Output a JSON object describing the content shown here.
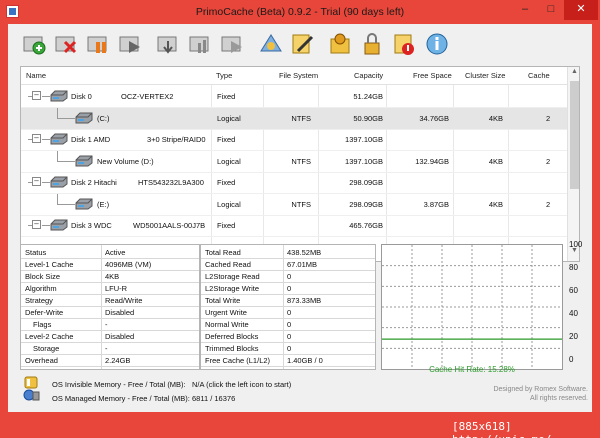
{
  "window": {
    "title": "PrimoCache (Beta) 0.9.2 - Trial (90 days left)",
    "accent": "#e8463a",
    "buttons": {
      "minimize": "–",
      "maximize": "□",
      "close": "✕"
    }
  },
  "toolbar": {
    "icons": [
      "add-cache-icon",
      "delete-cache-icon",
      "pause-cache-icon",
      "resume-cache-icon",
      "flush-cache-icon",
      "stats-icon",
      "play-icon",
      "settings-icon",
      "edit-icon",
      "options-icon",
      "lock-icon",
      "help-icon",
      "about-icon"
    ]
  },
  "tree": {
    "columns": [
      "Name",
      "Type",
      "File System",
      "Capacity",
      "Free Space",
      "Cluster Size",
      "Cache"
    ],
    "rows": [
      {
        "name": "Disk 0",
        "model": "OCZ-VERTEX2",
        "type": "Fixed",
        "fs": "",
        "capacity": "51.24GB",
        "free": "",
        "cluster": "",
        "cache": "",
        "level": 0
      },
      {
        "name": "(C:)",
        "model": "",
        "type": "Logical",
        "fs": "NTFS",
        "capacity": "50.90GB",
        "free": "34.76GB",
        "cluster": "4KB",
        "cache": "2",
        "level": 1,
        "selected": true
      },
      {
        "name": "Disk 1 AMD",
        "model": "3+0 Stripe/RAID0",
        "type": "Fixed",
        "fs": "",
        "capacity": "1397.10GB",
        "free": "",
        "cluster": "",
        "cache": "",
        "level": 0
      },
      {
        "name": "New Volume (D:)",
        "model": "",
        "type": "Logical",
        "fs": "NTFS",
        "capacity": "1397.10GB",
        "free": "132.94GB",
        "cluster": "4KB",
        "cache": "2",
        "level": 1
      },
      {
        "name": "Disk 2 Hitachi",
        "model": "HTS543232L9A300",
        "type": "Fixed",
        "fs": "",
        "capacity": "298.09GB",
        "free": "",
        "cluster": "",
        "cache": "",
        "level": 0
      },
      {
        "name": "(E:)",
        "model": "",
        "type": "Logical",
        "fs": "NTFS",
        "capacity": "298.09GB",
        "free": "3.87GB",
        "cluster": "4KB",
        "cache": "2",
        "level": 1
      },
      {
        "name": "Disk 3 WDC",
        "model": "WD5001AALS-00J7B",
        "type": "Fixed",
        "fs": "",
        "capacity": "465.76GB",
        "free": "",
        "cluster": "",
        "cache": "",
        "level": 0
      }
    ]
  },
  "status": [
    {
      "k": "Status",
      "v": "Active"
    },
    {
      "k": "Level-1 Cache",
      "v": "4096MB (VM)"
    },
    {
      "k": "Block Size",
      "v": "4KB"
    },
    {
      "k": "Algorithm",
      "v": "LFU-R"
    },
    {
      "k": "Strategy",
      "v": "Read/Write"
    },
    {
      "k": "Defer-Write",
      "v": "Disabled"
    },
    {
      "k": "Flags",
      "v": "-",
      "indent": true
    },
    {
      "k": "Level-2 Cache",
      "v": "Disabled"
    },
    {
      "k": "Storage",
      "v": "-",
      "indent": true
    },
    {
      "k": "Overhead",
      "v": "2.24GB"
    }
  ],
  "stats": [
    {
      "k": "Total Read",
      "v": "438.52MB"
    },
    {
      "k": "Cached Read",
      "v": "67.01MB"
    },
    {
      "k": "L2Storage Read",
      "v": "0"
    },
    {
      "k": "L2Storage Write",
      "v": "0"
    },
    {
      "k": "Total Write",
      "v": "873.33MB"
    },
    {
      "k": "Urgent Write",
      "v": "0"
    },
    {
      "k": "Normal Write",
      "v": "0"
    },
    {
      "k": "Deferred Blocks",
      "v": "0"
    },
    {
      "k": "Trimmed Blocks",
      "v": "0"
    },
    {
      "k": "Free Cache (L1/L2)",
      "v": "1.40GB / 0"
    }
  ],
  "graph": {
    "y_ticks": [
      "100",
      "80",
      "60",
      "40",
      "20",
      "0"
    ],
    "hit_rate_label": "Cache Hit Rate: 15.28%",
    "hit_rate": 15.28,
    "line_color": "#2a9a2a"
  },
  "footer": {
    "invisible_label": "OS Invisible Memory - Free / Total (MB):",
    "invisible_value": "N/A (click the left icon to start)",
    "managed_label": "OS Managed Memory - Free / Total (MB):",
    "managed_value": "6811 / 16376",
    "credit1": "Designed by Romex Software.",
    "credit2": "All rights reserved."
  },
  "stamp": "[885x618] http://upic.me/"
}
